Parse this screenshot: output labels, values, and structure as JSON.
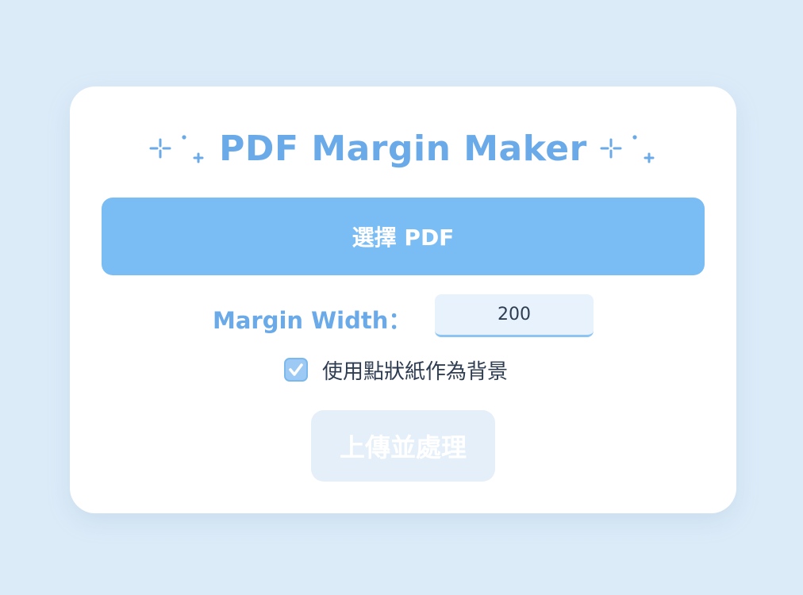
{
  "app": {
    "title": "PDF Margin Maker",
    "title_sparkle_left": "⊹˚₊",
    "title_sparkle_right": "⊹˚₊"
  },
  "file": {
    "choose_label": "選擇 PDF"
  },
  "margin": {
    "label": "Margin Width：",
    "value": "200"
  },
  "background": {
    "checked": true,
    "label": "使用點狀紙作為背景"
  },
  "process": {
    "label": "上傳並處理",
    "enabled": false
  },
  "colors": {
    "page_bg": "#dcebf8",
    "accent": "#6aaae8",
    "button": "#7abdf4",
    "disabled_button": "#e4eff9",
    "text": "#2f3d52"
  }
}
